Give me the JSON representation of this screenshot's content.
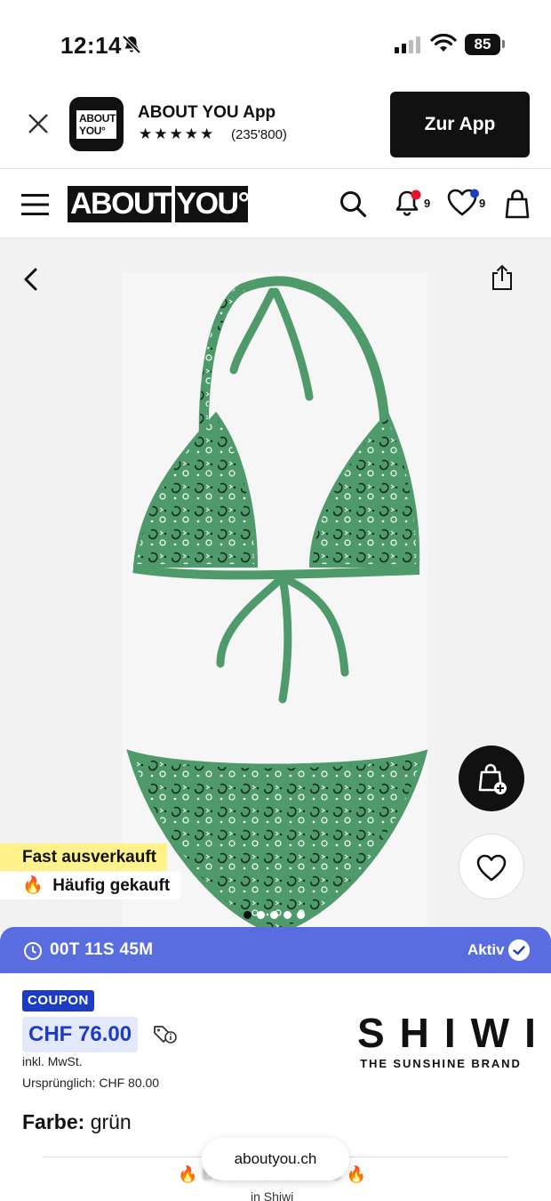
{
  "status_bar": {
    "time": "12:14",
    "battery": "85"
  },
  "app_banner": {
    "icon_text_line1": "ABOUT",
    "icon_text_line2": "YOU°",
    "app_name": "ABOUT YOU App",
    "stars": "★★★★★",
    "rating_count": "(235'800)",
    "cta_label": "Zur App"
  },
  "header": {
    "logo_part1": "ABOUT",
    "logo_part2": "YOU°",
    "notification_count": "9",
    "wishlist_count": "9",
    "notification_dot_color": "#e5132b",
    "wishlist_dot_color": "#1d3cc4"
  },
  "gallery": {
    "tag_fast": "Fast ausverkauft",
    "tag_hot_icon": "🔥",
    "tag_hot": "Häufig gekauft",
    "current_image": 1,
    "image_count": 5
  },
  "timer": {
    "countdown": "00T 11S 45M",
    "status": "Aktiv"
  },
  "product": {
    "coupon": "COUPON",
    "price": "CHF 76.00",
    "vat_note": "inkl. MwSt.",
    "original_price": "Ursprünglich:  CHF 80.00",
    "brand_name": "SHIWI",
    "brand_tagline": "THE SUNSHINE BRAND",
    "color_label": "Farbe:",
    "color_value": "grün",
    "product_color": "#4f9a6b"
  },
  "bottom": {
    "url": "aboutyou.ch",
    "bestseller_icon": "🔥",
    "bestseller_text": "BESTSELLER #3",
    "bestseller_sub": "in Shiwi"
  },
  "colors": {
    "accent": "#1d3cc4",
    "timer_bg": "#5a6de0",
    "tag_yellow": "#fff28a"
  }
}
